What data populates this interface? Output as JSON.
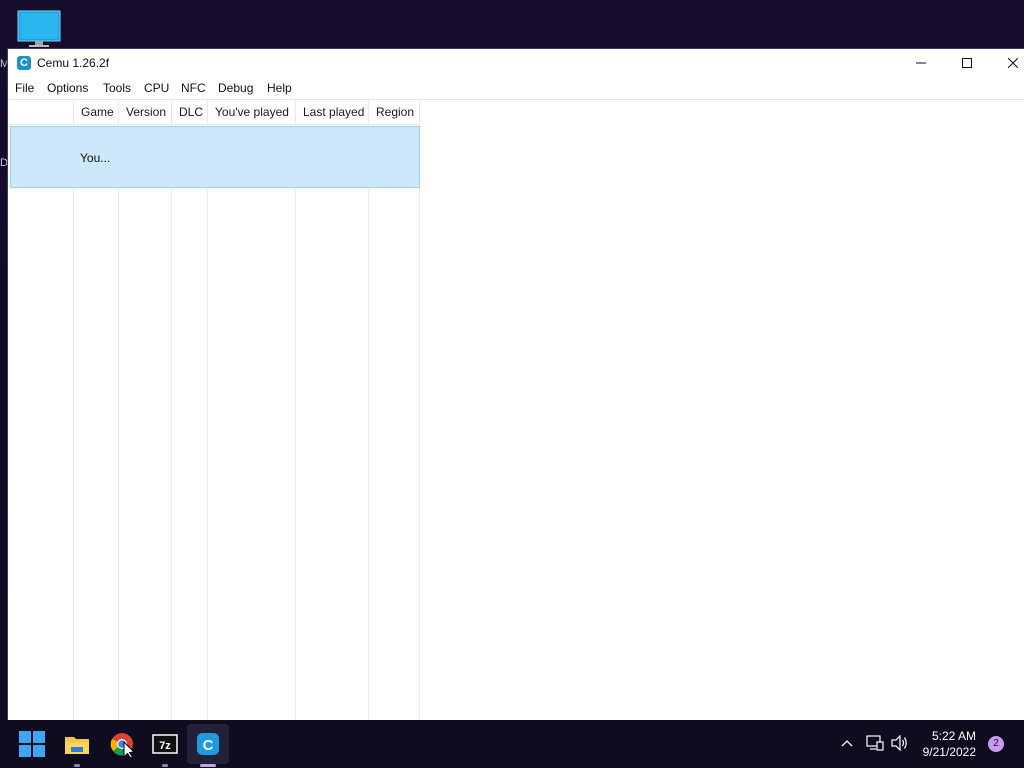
{
  "window": {
    "title": "Cemu 1.26.2f",
    "app_icon_letter": "C",
    "minimize_icon": "minimize-icon",
    "maximize_icon": "maximize-icon",
    "close_icon": "close-icon"
  },
  "menu": {
    "items": [
      "File",
      "Options",
      "Tools",
      "CPU",
      "NFC",
      "Debug",
      "Help"
    ]
  },
  "game_list": {
    "columns": [
      "",
      "Game",
      "Version",
      "DLC",
      "You've played",
      "Last played",
      "Region"
    ],
    "rows": [
      {
        "icon": "",
        "game": "You...",
        "version": "",
        "dlc": "",
        "played": "",
        "last_played": "",
        "region": "",
        "selected": true
      }
    ]
  },
  "desktop": {
    "edge_glyph_1": "M",
    "edge_glyph_2": "D"
  },
  "taskbar": {
    "time": "5:22 AM",
    "date": "9/21/2022",
    "notification_count": "2",
    "apps": [
      "start-icon",
      "file-explorer-icon",
      "chrome-icon",
      "7zip-icon",
      "cemu-icon"
    ],
    "tray": [
      "chevron-up-icon",
      "network-icon",
      "volume-icon"
    ],
    "accent": "#c79cf0"
  },
  "colors": {
    "selection": "#cce8fa",
    "selection_border": "#99d1f7"
  }
}
